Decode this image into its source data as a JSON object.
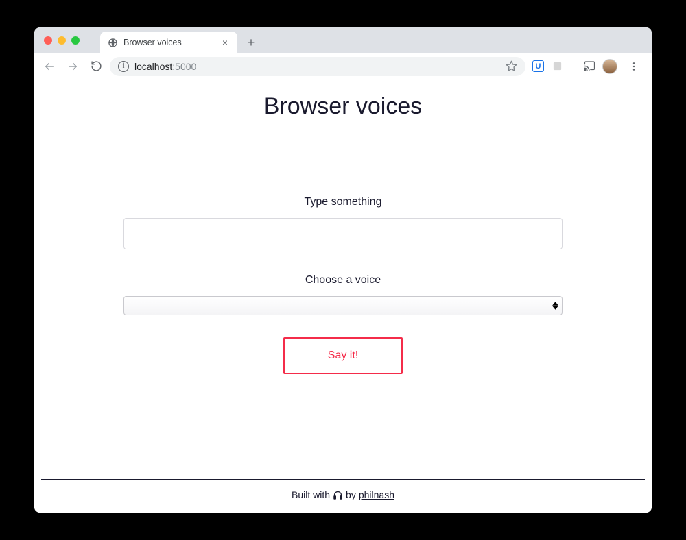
{
  "browser": {
    "tab_title": "Browser voices",
    "url_host": "localhost",
    "url_port": ":5000",
    "new_tab_glyph": "+",
    "close_glyph": "×"
  },
  "page": {
    "title": "Browser voices",
    "input_label": "Type something",
    "input_value": "",
    "select_label": "Choose a voice",
    "select_value": "",
    "submit_label": "Say it!"
  },
  "footer": {
    "prefix": "Built with",
    "by": "by",
    "author": "philnash"
  },
  "colors": {
    "accent": "#f42c4a",
    "text": "#1a1a2e"
  }
}
